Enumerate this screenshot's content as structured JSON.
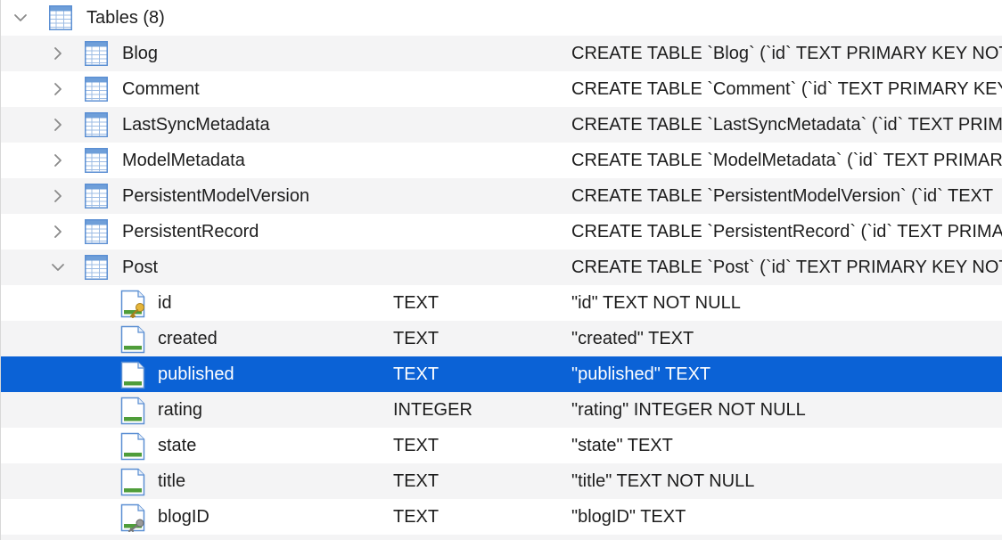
{
  "root": {
    "label": "Tables (8)",
    "expanded": true
  },
  "tables": [
    {
      "name": "Blog",
      "schema": "CREATE TABLE `Blog` (`id` TEXT PRIMARY KEY NOT NULL",
      "expanded": false
    },
    {
      "name": "Comment",
      "schema": "CREATE TABLE `Comment` (`id` TEXT PRIMARY KEY NOT NULL",
      "expanded": false
    },
    {
      "name": "LastSyncMetadata",
      "schema": "CREATE TABLE `LastSyncMetadata` (`id` TEXT PRIMARY KEY",
      "expanded": false
    },
    {
      "name": "ModelMetadata",
      "schema": "CREATE TABLE `ModelMetadata` (`id` TEXT PRIMARY KEY",
      "expanded": false
    },
    {
      "name": "PersistentModelVersion",
      "schema": "CREATE TABLE `PersistentModelVersion` (`id` TEXT",
      "expanded": false
    },
    {
      "name": "PersistentRecord",
      "schema": "CREATE TABLE `PersistentRecord` (`id` TEXT PRIMARY",
      "expanded": false
    },
    {
      "name": "Post",
      "schema": "CREATE TABLE `Post` (`id` TEXT PRIMARY KEY NOT NULL",
      "expanded": true
    }
  ],
  "post_columns": [
    {
      "name": "id",
      "type": "TEXT",
      "schema": "\"id\" TEXT NOT NULL",
      "icon": "primary-key-column-icon",
      "selected": false
    },
    {
      "name": "created",
      "type": "TEXT",
      "schema": "\"created\" TEXT",
      "icon": "column-icon",
      "selected": false
    },
    {
      "name": "published",
      "type": "TEXT",
      "schema": "\"published\" TEXT",
      "icon": "column-icon",
      "selected": true
    },
    {
      "name": "rating",
      "type": "INTEGER",
      "schema": "\"rating\" INTEGER NOT NULL",
      "icon": "column-icon",
      "selected": false
    },
    {
      "name": "state",
      "type": "TEXT",
      "schema": "\"state\" TEXT",
      "icon": "column-icon",
      "selected": false
    },
    {
      "name": "title",
      "type": "TEXT",
      "schema": "\"title\" TEXT NOT NULL",
      "icon": "column-icon",
      "selected": false
    },
    {
      "name": "blogID",
      "type": "TEXT",
      "schema": "\"blogID\" TEXT",
      "icon": "foreign-key-column-icon",
      "selected": false
    }
  ],
  "colors": {
    "selection": "#0b62d6",
    "alternate_row": "#f4f4f5",
    "table_icon_blue": "#5b8fd3",
    "column_icon_green": "#4f9d3a",
    "key_gold": "#e5b53a"
  }
}
